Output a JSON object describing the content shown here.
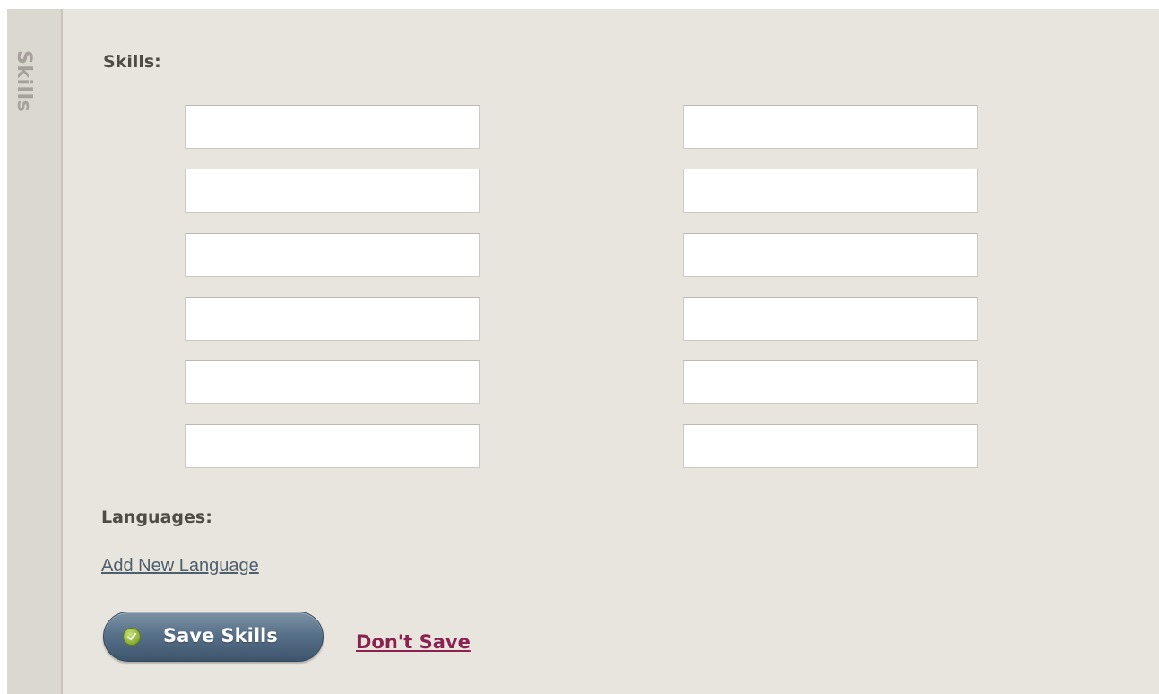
{
  "side_tab": {
    "label": "Skills"
  },
  "skills_section": {
    "heading": "Skills:",
    "left_inputs": [
      "",
      "",
      "",
      "",
      "",
      ""
    ],
    "right_inputs": [
      "",
      "",
      "",
      "",
      "",
      ""
    ]
  },
  "languages_section": {
    "heading": "Languages:",
    "add_link": "Add New Language"
  },
  "actions": {
    "save_label": "Save Skills",
    "save_icon": "check-icon",
    "dont_save_label": "Don't Save"
  },
  "colors": {
    "panel_background": "#e8e5de",
    "side_tab_background": "#dbd8d0",
    "save_button": "#58718a",
    "dont_save_link": "#8a2150",
    "check_icon": "#8fb43a"
  }
}
